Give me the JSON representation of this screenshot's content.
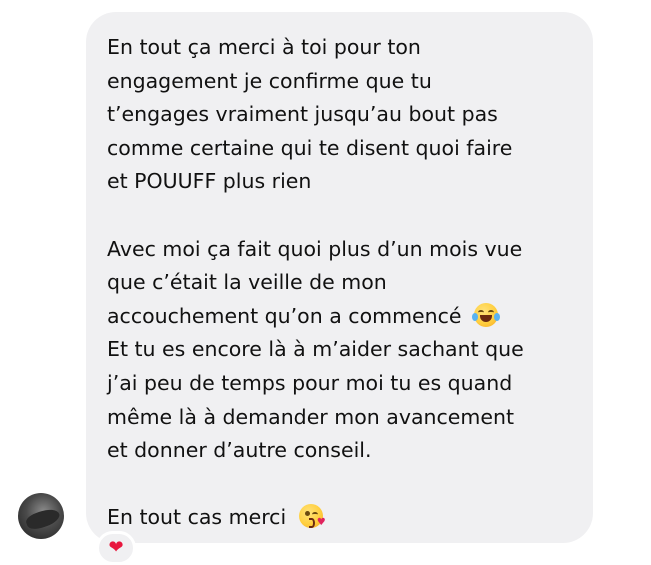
{
  "message": {
    "lines": [
      "En tout ça merci à toi pour ton",
      "engagement je confirme que tu",
      "t’engages vraiment jusqu’au bout pas",
      "comme certaine qui te disent quoi faire",
      "et POUUFF plus rien",
      "",
      "Avec moi ça fait quoi plus d’un mois vue",
      "que c’était la veille de mon",
      "accouchement qu’on a commencé",
      "Et tu es encore là à m’aider sachant que",
      "j’ai peu de temps pour moi tu es quand",
      "même là à demander mon avancement",
      "et donner d’autre conseil.",
      "",
      "En tout cas merci"
    ],
    "emojis": {
      "line_8": "laughing-with-tears-emoji",
      "line_14": "kissing-face-emoji"
    }
  },
  "reaction": {
    "glyph": "❤",
    "color": "#e8173e"
  },
  "colors": {
    "bubble": "#f0f0f2",
    "text": "#111111"
  }
}
